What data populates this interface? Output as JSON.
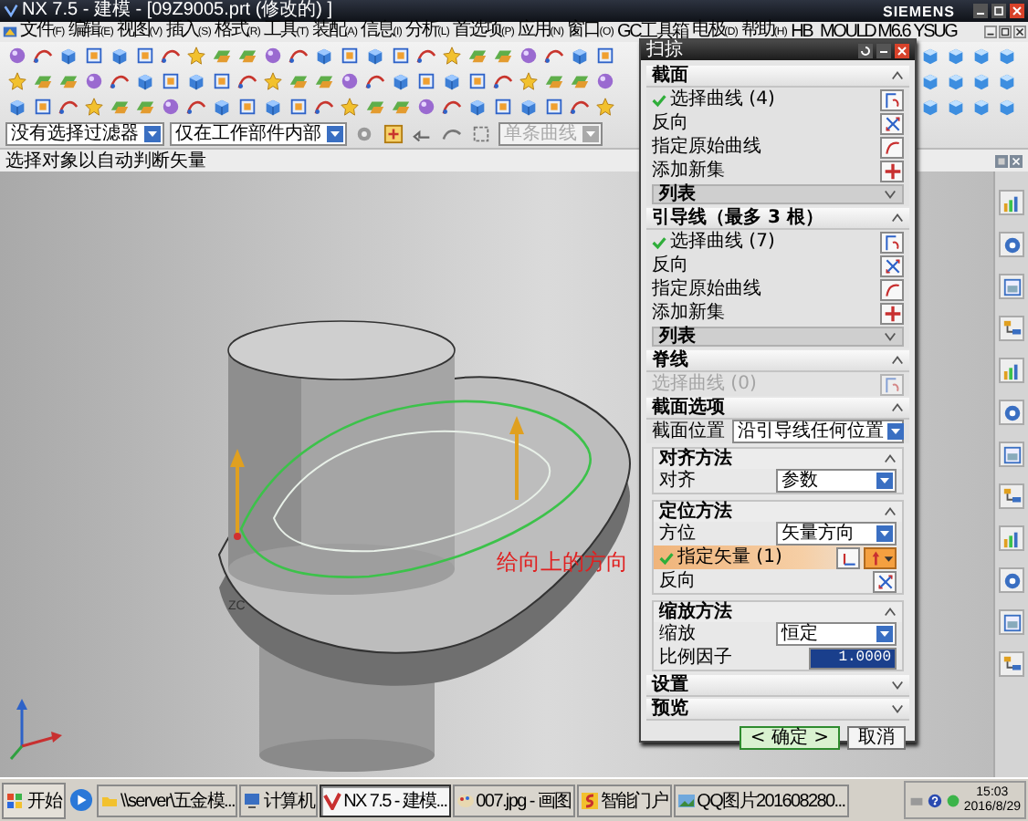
{
  "window": {
    "title": "NX 7.5 - 建模 - [09Z9005.prt  (修改的) ]",
    "brand": "SIEMENS"
  },
  "menu": [
    {
      "label": "文件",
      "mnemonic": "(F)"
    },
    {
      "label": "编辑",
      "mnemonic": "(E)"
    },
    {
      "label": "视图",
      "mnemonic": "(V)"
    },
    {
      "label": "插入",
      "mnemonic": "(S)"
    },
    {
      "label": "格式",
      "mnemonic": "(R)"
    },
    {
      "label": "工具",
      "mnemonic": "(T)"
    },
    {
      "label": "装配",
      "mnemonic": "(A)"
    },
    {
      "label": "信息",
      "mnemonic": "(I)"
    },
    {
      "label": "分析",
      "mnemonic": "(L)"
    },
    {
      "label": "首选项",
      "mnemonic": "(P)"
    },
    {
      "label": "应用",
      "mnemonic": "(N)"
    },
    {
      "label": "窗口",
      "mnemonic": "(O)"
    },
    {
      "label": "GC工具箱"
    },
    {
      "label": "电极",
      "mnemonic": "(D)"
    },
    {
      "label": "帮助",
      "mnemonic": "(H)"
    },
    {
      "label": "HB_MOULD M6.6"
    },
    {
      "label": "YSUG"
    }
  ],
  "filter_bar": {
    "type_filter": "没有选择过滤器",
    "scope": "仅在工作部件内部",
    "curve_rule": "单条曲线"
  },
  "prompt": "选择对象以自动判断矢量",
  "viewport": {
    "annotation": "给向上的方向",
    "axis_label": "ZC"
  },
  "dialog": {
    "title": "扫掠",
    "sections": [
      {
        "kind": "group",
        "title": "截面",
        "expanded": true,
        "rows": [
          {
            "kind": "select",
            "label": "选择曲线 (4)",
            "done": true,
            "disabled": false
          },
          {
            "kind": "reverse",
            "label": "反向"
          },
          {
            "kind": "origin",
            "label": "指定原始曲线"
          },
          {
            "kind": "add-set",
            "label": "添加新集"
          },
          {
            "kind": "list",
            "label": "列表"
          }
        ]
      },
      {
        "kind": "group",
        "title": "引导线（最多 3 根）",
        "expanded": true,
        "rows": [
          {
            "kind": "select",
            "label": "选择曲线 (7)",
            "done": true,
            "disabled": false
          },
          {
            "kind": "reverse",
            "label": "反向"
          },
          {
            "kind": "origin",
            "label": "指定原始曲线"
          },
          {
            "kind": "add-set",
            "label": "添加新集"
          },
          {
            "kind": "list",
            "label": "列表"
          }
        ]
      },
      {
        "kind": "group",
        "title": "脊线",
        "expanded": true,
        "rows": [
          {
            "kind": "select",
            "label": "选择曲线 (0)",
            "done": false,
            "disabled": true
          }
        ]
      },
      {
        "kind": "group",
        "title": "截面选项",
        "expanded": true,
        "rows": [
          {
            "kind": "dropdown",
            "label": "截面位置",
            "value": "沿引导线任何位置"
          },
          {
            "kind": "subgroup",
            "title": "对齐方法",
            "expanded": true,
            "rows": [
              {
                "kind": "dropdown",
                "label": "对齐",
                "value": "参数"
              }
            ]
          },
          {
            "kind": "subgroup",
            "title": "定位方法",
            "expanded": true,
            "rows": [
              {
                "kind": "dropdown",
                "label": "方位",
                "value": "矢量方向"
              },
              {
                "kind": "vector",
                "label": "指定矢量 (1)",
                "done": true,
                "active": true
              },
              {
                "kind": "reverse",
                "label": "反向"
              }
            ]
          },
          {
            "kind": "subgroup",
            "title": "缩放方法",
            "expanded": true,
            "rows": [
              {
                "kind": "dropdown",
                "label": "缩放",
                "value": "恒定"
              },
              {
                "kind": "number",
                "label": "比例因子",
                "value": "1.0000",
                "selected": true
              }
            ]
          }
        ]
      },
      {
        "kind": "group",
        "title": "设置",
        "expanded": false
      },
      {
        "kind": "group",
        "title": "预览",
        "expanded": false
      }
    ],
    "buttons": [
      {
        "label": "< 确定 >",
        "default": true
      },
      {
        "label": "取消",
        "default": false
      }
    ]
  },
  "taskbar": {
    "start": "开始",
    "tasks": [
      {
        "kind": "folder",
        "label": "\\\\server\\五金模...",
        "selected": false
      },
      {
        "kind": "computer",
        "label": "计算机",
        "selected": false
      },
      {
        "kind": "nx",
        "label": "NX 7.5 - 建模...",
        "selected": true
      },
      {
        "kind": "paint",
        "label": "007.jpg - 画图",
        "selected": false
      },
      {
        "kind": "portal",
        "label": "智能门户",
        "selected": false
      },
      {
        "kind": "image",
        "label": "QQ图片201608280...",
        "selected": false
      }
    ],
    "time": "15:03",
    "date": "2016/8/29"
  }
}
